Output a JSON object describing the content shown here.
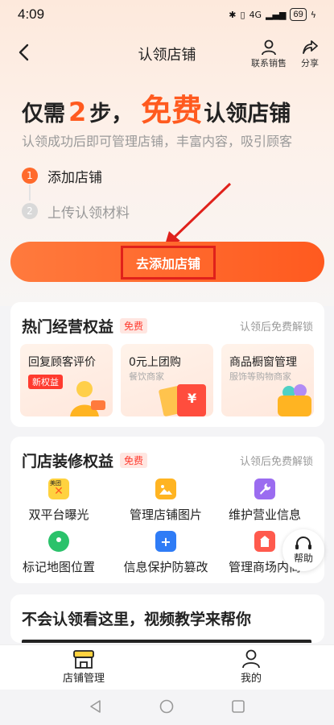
{
  "status": {
    "time": "4:09",
    "network": "4G",
    "battery": "69"
  },
  "nav": {
    "title": "认领店铺",
    "contact_label": "联系销售",
    "share_label": "分享"
  },
  "hero": {
    "prefix": "仅需",
    "steps_count": "2",
    "steps_word": "步，",
    "free": "免费",
    "suffix": "认领店铺",
    "subtitle": "认领成功后即可管理店铺，丰富内容，吸引顾客"
  },
  "steps": [
    {
      "num": "1",
      "label": "添加店铺"
    },
    {
      "num": "2",
      "label": "上传认领材料"
    }
  ],
  "cta": {
    "label": "去添加店铺"
  },
  "hot_benefits": {
    "title": "热门经营权益",
    "tag": "免费",
    "hint": "认领后免费解锁",
    "items": [
      {
        "title": "回复顾客评价",
        "tag": "新权益"
      },
      {
        "title": "0元上团购",
        "sub": "餐饮商家",
        "coupon": "¥"
      },
      {
        "title": "商品橱窗管理",
        "sub": "服饰等购物商家"
      }
    ]
  },
  "decor_benefits": {
    "title": "门店装修权益",
    "tag": "免费",
    "hint": "认领后免费解锁",
    "items": [
      {
        "label": "双平台曝光",
        "icon": "dual-platform-icon",
        "badge": "美团"
      },
      {
        "label": "管理店铺图片",
        "icon": "image-icon"
      },
      {
        "label": "维护营业信息",
        "icon": "wrench-icon"
      },
      {
        "label": "标记地图位置",
        "icon": "map-pin-icon"
      },
      {
        "label": "信息保护防篡改",
        "icon": "shield-plus-icon"
      },
      {
        "label": "管理商场内商",
        "icon": "mall-icon"
      }
    ]
  },
  "help": {
    "label": "帮助"
  },
  "video": {
    "title": "不会认领看这里，视频教学来帮你"
  },
  "tabbar": {
    "store_label": "店铺管理",
    "mine_label": "我的"
  },
  "colors": {
    "accent": "#ff5a1f",
    "highlight_border": "#e0211b",
    "free_tag": "#ff3b2f"
  }
}
